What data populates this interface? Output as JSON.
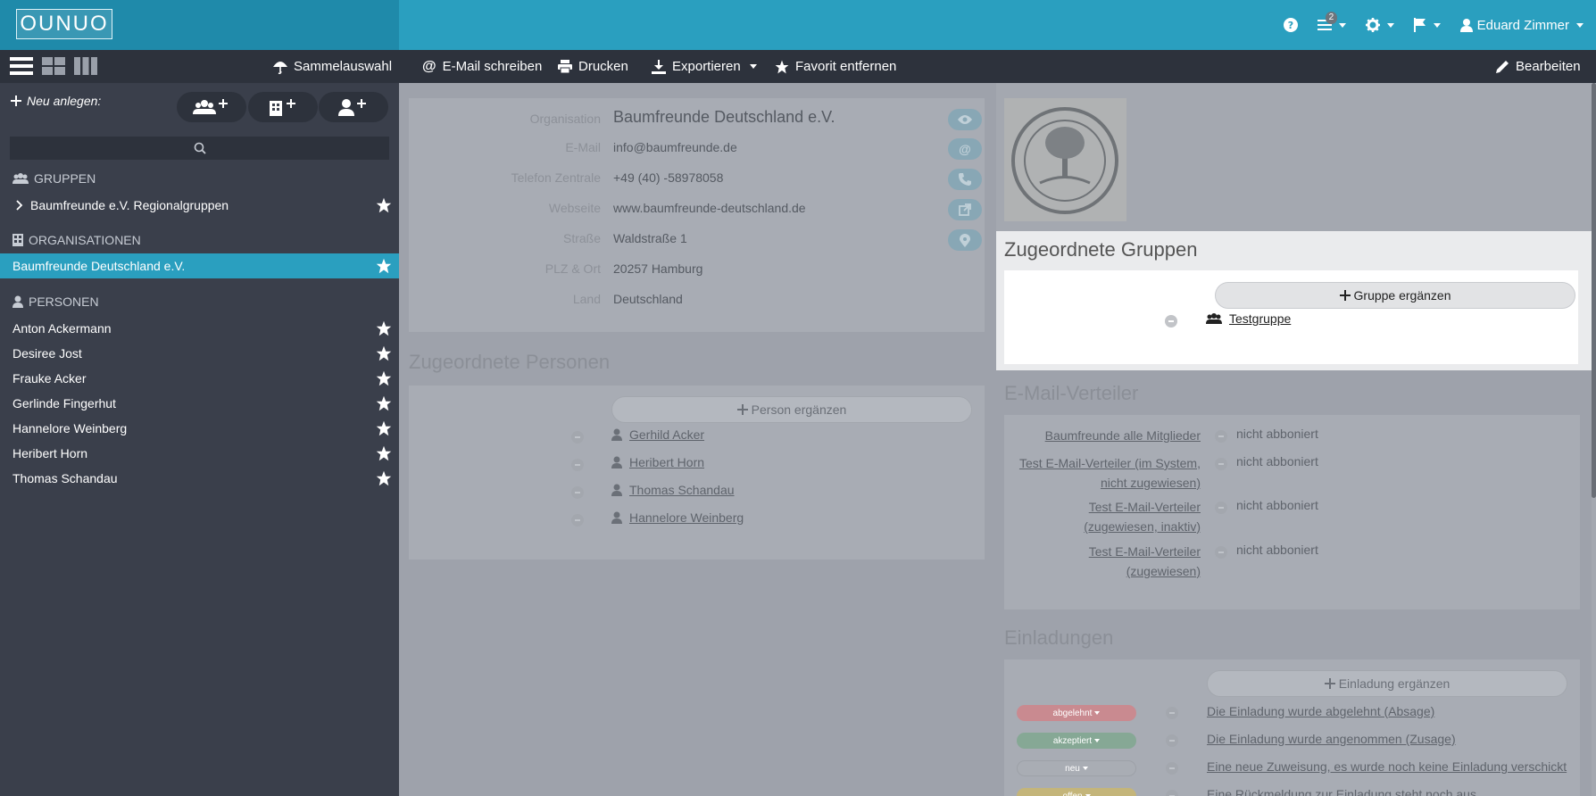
{
  "app": {
    "logo_text": "OUNUO",
    "notification_count": "2",
    "user_name": "Eduard Zimmer"
  },
  "toolbar": {
    "collective": "Sammelauswahl",
    "email": "E-Mail schreiben",
    "print": "Drucken",
    "export": "Exportieren",
    "favorite": "Favorit entfernen",
    "edit": "Bearbeiten"
  },
  "sidebar": {
    "new_label": "Neu anlegen:",
    "groups_heading": "Gruppen",
    "groups": [
      {
        "label": "Baumfreunde e.V. Regionalgruppen"
      }
    ],
    "orgs_heading": "Organisationen",
    "orgs": [
      {
        "label": "Baumfreunde Deutschland e.V."
      }
    ],
    "persons_heading": "Personen",
    "persons": [
      {
        "label": "Anton Ackermann"
      },
      {
        "label": "Desiree Jost"
      },
      {
        "label": "Frauke Acker"
      },
      {
        "label": "Gerlinde Fingerhut"
      },
      {
        "label": "Hannelore Weinberg"
      },
      {
        "label": "Heribert Horn"
      },
      {
        "label": "Thomas Schandau"
      }
    ]
  },
  "org": {
    "fields": [
      {
        "label": "Organisation",
        "value": "Baumfreunde Deutschland e.V."
      },
      {
        "label": "E-Mail",
        "value": "info@baumfreunde.de"
      },
      {
        "label": "Telefon Zentrale",
        "value": "+49 (40) -58978058"
      },
      {
        "label": "Webseite",
        "value": "www.baumfreunde-deutschland.de"
      },
      {
        "label": "Straße",
        "value": "Waldstraße 1"
      },
      {
        "label": "PLZ & Ort",
        "value": "20257 Hamburg"
      },
      {
        "label": "Land",
        "value": "Deutschland"
      }
    ]
  },
  "persons_section": {
    "title": "Zugeordnete Personen",
    "add_label": "Person ergänzen",
    "items": [
      {
        "label": "Gerhild Acker"
      },
      {
        "label": "Heribert Horn"
      },
      {
        "label": "Thomas Schandau"
      },
      {
        "label": "Hannelore Weinberg"
      }
    ]
  },
  "groups_section": {
    "title": "Zugeordnete Gruppen",
    "add_label": "Gruppe ergänzen",
    "items": [
      {
        "label": "Testgruppe"
      }
    ]
  },
  "distribution": {
    "title": "E-Mail-Verteiler",
    "items": [
      {
        "line1": "Baumfreunde alle Mitglieder",
        "line2": "",
        "status": "nicht abboniert"
      },
      {
        "line1": "Test E-Mail-Verteiler (im System,",
        "line2": "nicht zugewiesen)",
        "status": "nicht abboniert"
      },
      {
        "line1": "Test E-Mail-Verteiler",
        "line2": "(zugewiesen, inaktiv)",
        "status": "nicht abboniert"
      },
      {
        "line1": "Test E-Mail-Verteiler",
        "line2": "(zugewiesen)",
        "status": "nicht abboniert"
      }
    ]
  },
  "invitations": {
    "title": "Einladungen",
    "add_label": "Einladung ergänzen",
    "items": [
      {
        "badge": "abgelehnt",
        "color": "#c98a90",
        "text": "Die Einladung wurde abgelehnt (Absage)"
      },
      {
        "badge": "akzeptiert",
        "color": "#86a895",
        "text": "Die Einladung wurde angenommen (Zusage)"
      },
      {
        "badge": "neu",
        "color": "#a9adb4",
        "text": "Eine neue Zuweisung, es wurde noch keine Einladung verschickt"
      },
      {
        "badge": "offen",
        "color": "#c4b57a",
        "text": "Eine Rückmeldung zur Einladung steht noch aus"
      }
    ]
  },
  "colors": {
    "accent": "#2a9fbf",
    "sidebar": "#3a3f4b",
    "toolbar": "#2d323c"
  }
}
